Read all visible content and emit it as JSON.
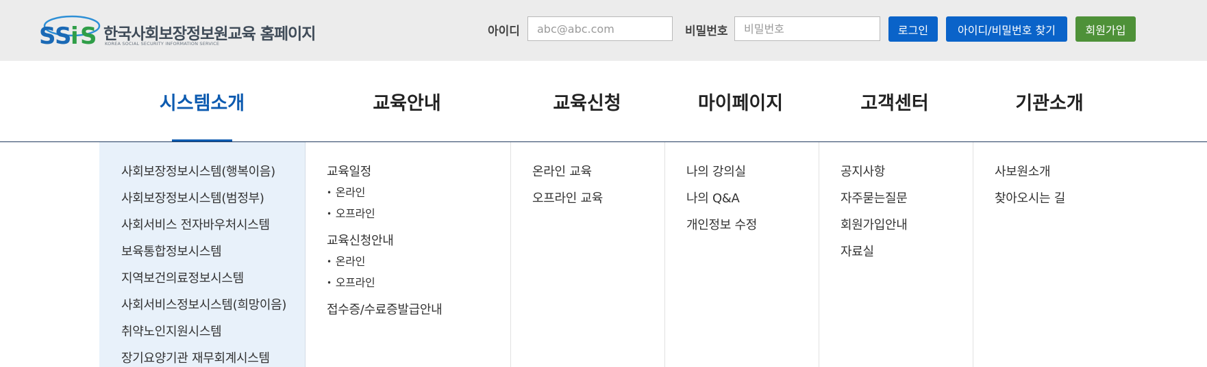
{
  "header": {
    "logo": {
      "mark": "SSiS",
      "title": "한국사회보장정보원",
      "title_suffix": "교육 홈페이지",
      "subtitle": "KOREA SOCIAL SECURITY INFORMATION SERVICE"
    },
    "login": {
      "id_label": "아이디",
      "id_placeholder": "abc@abc.com",
      "password_label": "비밀번호",
      "password_placeholder": "비밀번호",
      "login_button": "로그인",
      "find_button": "아이디/비밀번호 찾기",
      "signup_button": "회원가입"
    },
    "colors": {
      "primary": "#0a63c9",
      "signup": "#4e9138",
      "active_nav": "#0d5bb0"
    }
  },
  "nav": {
    "active": "시스템소개",
    "items": [
      {
        "label": "시스템소개"
      },
      {
        "label": "교육안내"
      },
      {
        "label": "교육신청"
      },
      {
        "label": "마이페이지"
      },
      {
        "label": "고객센터"
      },
      {
        "label": "기관소개"
      }
    ]
  },
  "megamenu": {
    "system": [
      "사회보장정보시스템(행복이음)",
      "사회보장정보시스템(범정부)",
      "사회서비스 전자바우처시스템",
      "보육통합정보시스템",
      "지역보건의료정보시스템",
      "사회서비스정보시스템(희망이음)",
      "취약노인지원시스템",
      "장기요양기관 재무회계시스템"
    ],
    "edu_info": {
      "schedule": "교육일정",
      "schedule_online": "온라인",
      "schedule_offline": "오프라인",
      "apply_guide": "교육신청안내",
      "apply_online": "온라인",
      "apply_offline": "오프라인",
      "certificate": "접수증/수료증발급안내"
    },
    "edu_apply": [
      "온라인 교육",
      "오프라인 교육"
    ],
    "mypage": [
      "나의 강의실",
      "나의 Q&A",
      "개인정보 수정"
    ],
    "support": [
      "공지사항",
      "자주묻는질문",
      "회원가입안내",
      "자료실"
    ],
    "about": [
      "사보원소개",
      "찾아오시는 길"
    ]
  }
}
